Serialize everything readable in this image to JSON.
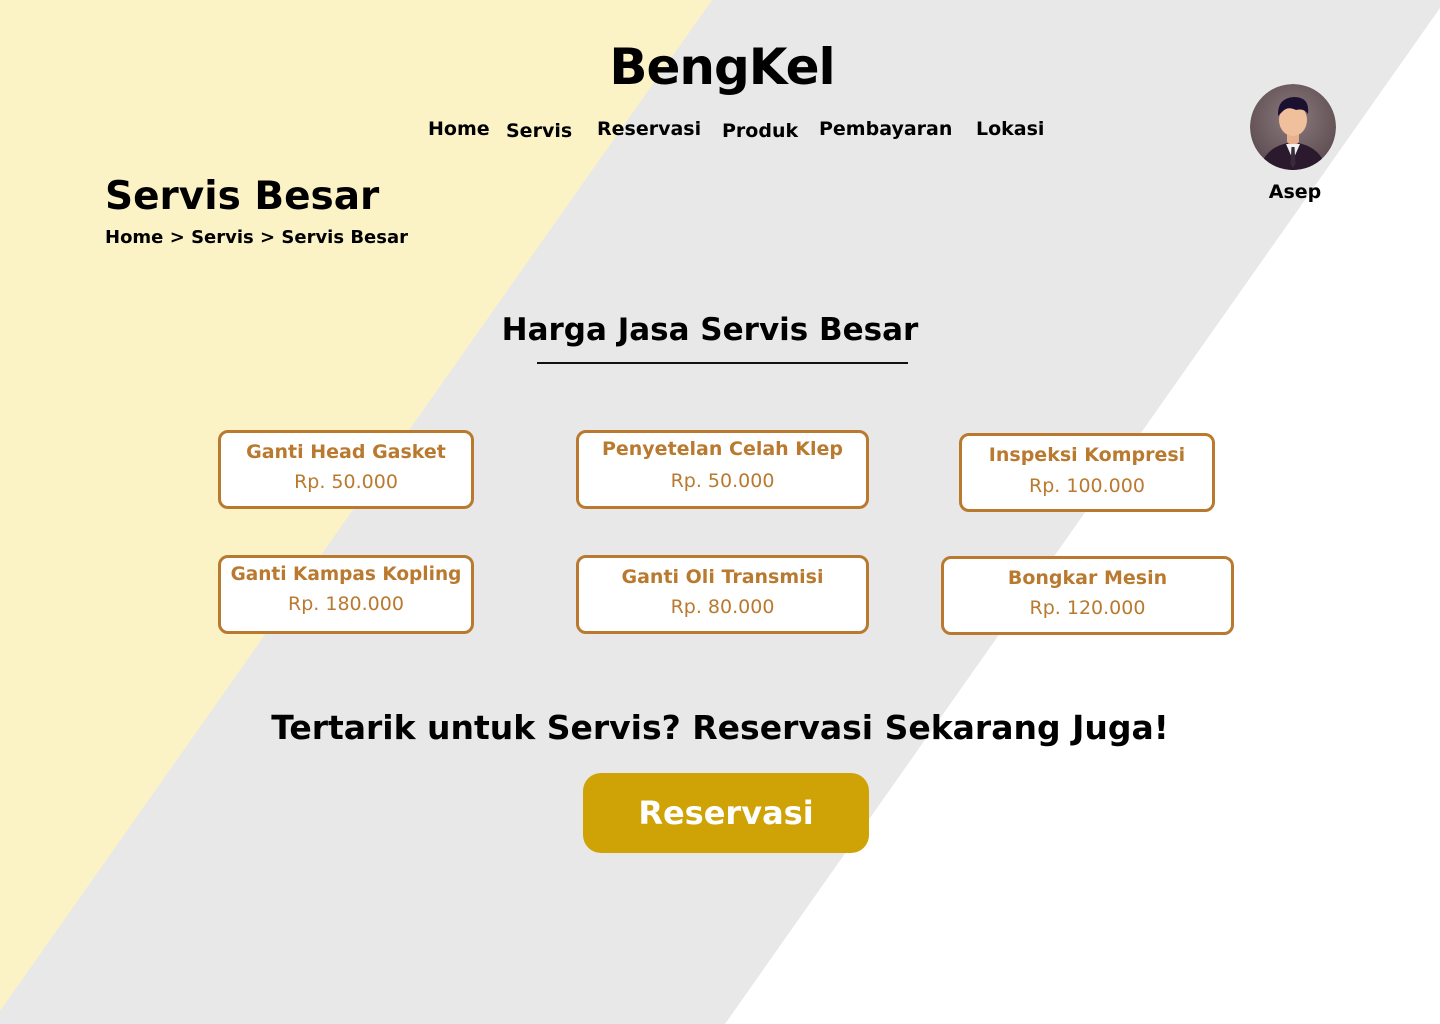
{
  "brand": {
    "logo": "BengKel"
  },
  "nav": {
    "items": [
      "Home",
      "Servis",
      "Reservasi",
      "Produk",
      "Pembayaran",
      "Lokasi"
    ]
  },
  "user": {
    "name": "Asep",
    "avatar_icon": "user-avatar-icon"
  },
  "page": {
    "title": "Servis Besar",
    "breadcrumb": [
      "Home",
      "Servis",
      "Servis Besar"
    ],
    "breadcrumb_separator": ">"
  },
  "pricing": {
    "title": "Harga Jasa Servis Besar",
    "services": [
      {
        "name": "Ganti Head Gasket",
        "price": "Rp. 50.000"
      },
      {
        "name": "Penyetelan Celah Klep",
        "price": "Rp. 50.000"
      },
      {
        "name": "Inspeksi Kompresi",
        "price": "Rp. 100.000"
      },
      {
        "name": "Ganti Kampas Kopling",
        "price": "Rp. 180.000"
      },
      {
        "name": "Ganti Oli Transmisi",
        "price": "Rp. 80.000"
      },
      {
        "name": "Bongkar Mesin",
        "price": "Rp. 120.000"
      }
    ]
  },
  "cta": {
    "text": "Tertarik untuk Servis? Reservasi Sekarang Juga!",
    "button_label": "Reservasi"
  },
  "colors": {
    "accent": "#b97a30",
    "button": "#cfa206",
    "bg_yellow": "#fbf2c6",
    "bg_gray": "#e8e8e8",
    "bg_white": "#ffffff"
  }
}
